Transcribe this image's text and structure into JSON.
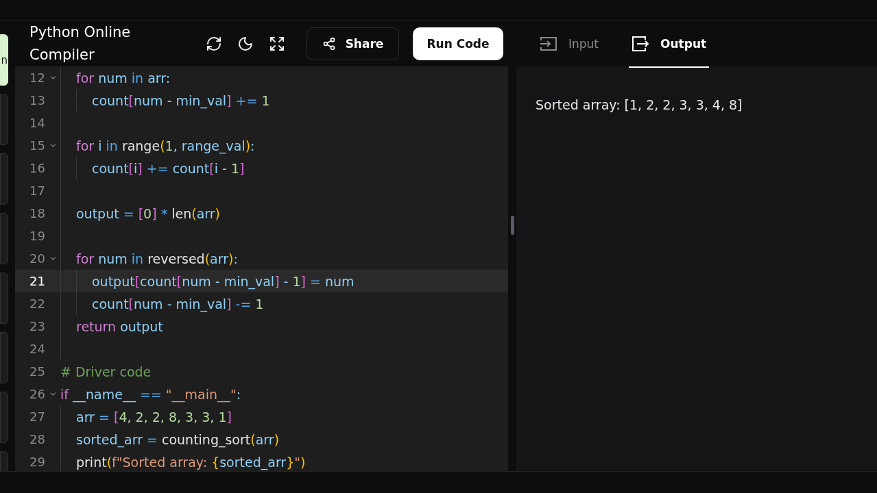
{
  "rail": {
    "items": [
      {
        "label": "n",
        "selected": true
      },
      {
        "selected": false
      },
      {
        "selected": false
      },
      {
        "selected": false
      },
      {
        "selected": false
      },
      {
        "selected": false
      },
      {
        "selected": false
      },
      {
        "selected": false
      }
    ]
  },
  "header": {
    "title": "Python Online Compiler",
    "share_button": "Share",
    "run_button": "Run Code"
  },
  "editor": {
    "function_body_lines": [
      {
        "number": "12",
        "foldable": true,
        "current": false,
        "tokens": [
          {
            "kind": "kw",
            "text": "for "
          },
          {
            "kind": "var",
            "text": "num "
          },
          {
            "kind": "op",
            "text": "in "
          },
          {
            "kind": "var",
            "text": "arr:"
          }
        ],
        "children": [
          {
            "number": "13",
            "foldable": false,
            "current": false,
            "tokens": [
              {
                "kind": "var",
                "text": "count"
              },
              {
                "kind": "br",
                "text": "["
              },
              {
                "kind": "var",
                "text": "num - min_val"
              },
              {
                "kind": "br",
                "text": "]"
              },
              {
                "kind": "op",
                "text": " += "
              },
              {
                "kind": "num",
                "text": "1"
              }
            ]
          }
        ]
      },
      {
        "number": "14",
        "foldable": false,
        "current": false
      },
      {
        "number": "15",
        "foldable": true,
        "current": false,
        "tokens": [
          {
            "kind": "kw",
            "text": "for "
          },
          {
            "kind": "var",
            "text": "i "
          },
          {
            "kind": "op",
            "text": "in "
          },
          {
            "kind": "fn",
            "text": "range"
          },
          {
            "kind": "par",
            "text": "("
          },
          {
            "kind": "num",
            "text": "1"
          },
          {
            "kind": "var",
            "text": ", range_val"
          },
          {
            "kind": "par",
            "text": ")"
          },
          {
            "kind": "var",
            "text": ":"
          }
        ],
        "children": [
          {
            "number": "16",
            "foldable": false,
            "current": false,
            "tokens": [
              {
                "kind": "var",
                "text": "count"
              },
              {
                "kind": "br",
                "text": "["
              },
              {
                "kind": "var",
                "text": "i"
              },
              {
                "kind": "br",
                "text": "]"
              },
              {
                "kind": "op",
                "text": " += "
              },
              {
                "kind": "var",
                "text": "count"
              },
              {
                "kind": "br",
                "text": "["
              },
              {
                "kind": "var",
                "text": "i - "
              },
              {
                "kind": "num",
                "text": "1"
              },
              {
                "kind": "br",
                "text": "]"
              }
            ]
          }
        ]
      },
      {
        "number": "17",
        "foldable": false,
        "current": false
      },
      {
        "number": "18",
        "foldable": false,
        "current": false,
        "tokens": [
          {
            "kind": "var",
            "text": "output "
          },
          {
            "kind": "op",
            "text": "= "
          },
          {
            "kind": "br",
            "text": "["
          },
          {
            "kind": "num",
            "text": "0"
          },
          {
            "kind": "br",
            "text": "]"
          },
          {
            "kind": "op",
            "text": " * "
          },
          {
            "kind": "fn",
            "text": "len"
          },
          {
            "kind": "par",
            "text": "("
          },
          {
            "kind": "var",
            "text": "arr"
          },
          {
            "kind": "par",
            "text": ")"
          }
        ]
      },
      {
        "number": "19",
        "foldable": false,
        "current": false
      },
      {
        "number": "20",
        "foldable": true,
        "current": false,
        "tokens": [
          {
            "kind": "kw",
            "text": "for "
          },
          {
            "kind": "var",
            "text": "num "
          },
          {
            "kind": "op",
            "text": "in "
          },
          {
            "kind": "fn",
            "text": "reversed"
          },
          {
            "kind": "par",
            "text": "("
          },
          {
            "kind": "var",
            "text": "arr"
          },
          {
            "kind": "par",
            "text": ")"
          },
          {
            "kind": "var",
            "text": ":"
          }
        ],
        "children": [
          {
            "number": "21",
            "foldable": false,
            "current": true,
            "tokens": [
              {
                "kind": "var",
                "text": "output"
              },
              {
                "kind": "br",
                "text": "["
              },
              {
                "kind": "var",
                "text": "count"
              },
              {
                "kind": "br",
                "text": "["
              },
              {
                "kind": "var",
                "text": "num - min_val"
              },
              {
                "kind": "br",
                "text": "]"
              },
              {
                "kind": "var",
                "text": " - "
              },
              {
                "kind": "num",
                "text": "1"
              },
              {
                "kind": "br",
                "text": "]"
              },
              {
                "kind": "op",
                "text": " = "
              },
              {
                "kind": "var",
                "text": "num"
              }
            ]
          },
          {
            "number": "22",
            "foldable": false,
            "current": false,
            "tokens": [
              {
                "kind": "var",
                "text": "count"
              },
              {
                "kind": "br",
                "text": "["
              },
              {
                "kind": "var",
                "text": "num - min_val"
              },
              {
                "kind": "br",
                "text": "]"
              },
              {
                "kind": "op",
                "text": " -= "
              },
              {
                "kind": "num",
                "text": "1"
              }
            ]
          }
        ]
      },
      {
        "number": "23",
        "foldable": false,
        "current": false,
        "tokens": [
          {
            "kind": "kw",
            "text": "return "
          },
          {
            "kind": "var",
            "text": "output"
          }
        ]
      },
      {
        "number": "24",
        "foldable": false,
        "current": false
      }
    ],
    "lines": [
      {
        "number": "25",
        "foldable": false,
        "current": false,
        "tokens": [
          {
            "kind": "cm",
            "text": "# Driver code"
          }
        ]
      },
      {
        "number": "26",
        "foldable": true,
        "current": false,
        "tokens": [
          {
            "kind": "kw",
            "text": "if "
          },
          {
            "kind": "var",
            "text": "__name__ "
          },
          {
            "kind": "op",
            "text": "== "
          },
          {
            "kind": "str",
            "text": "\"__main__\""
          },
          {
            "kind": "var",
            "text": ":"
          }
        ],
        "children": [
          {
            "number": "27",
            "foldable": false,
            "current": false,
            "tokens": [
              {
                "kind": "var",
                "text": "arr "
              },
              {
                "kind": "op",
                "text": "= "
              },
              {
                "kind": "br",
                "text": "["
              },
              {
                "kind": "num",
                "text": "4, 2, 2, 8, 3, 3, 1"
              },
              {
                "kind": "br",
                "text": "]"
              }
            ]
          },
          {
            "number": "28",
            "foldable": false,
            "current": false,
            "tokens": [
              {
                "kind": "var",
                "text": "sorted_arr "
              },
              {
                "kind": "op",
                "text": "= "
              },
              {
                "kind": "fn",
                "text": "counting_sort"
              },
              {
                "kind": "par",
                "text": "("
              },
              {
                "kind": "var",
                "text": "arr"
              },
              {
                "kind": "par",
                "text": ")"
              }
            ]
          },
          {
            "number": "29",
            "foldable": false,
            "current": false,
            "tokens": [
              {
                "kind": "fn",
                "text": "print"
              },
              {
                "kind": "par",
                "text": "("
              },
              {
                "kind": "str",
                "text": "f\"Sorted array: "
              },
              {
                "kind": "par",
                "text": "{"
              },
              {
                "kind": "var",
                "text": "sorted_arr"
              },
              {
                "kind": "par",
                "text": "}"
              },
              {
                "kind": "str",
                "text": "\""
              },
              {
                "kind": "par",
                "text": ")"
              }
            ]
          }
        ]
      }
    ]
  },
  "output_panel": {
    "tabs": [
      {
        "kind": "input",
        "label": "Input",
        "selected": false
      },
      {
        "kind": "output",
        "label": "Output",
        "selected": true
      }
    ],
    "text": "Sorted array: [1, 2, 2, 3, 3, 4, 8]"
  }
}
